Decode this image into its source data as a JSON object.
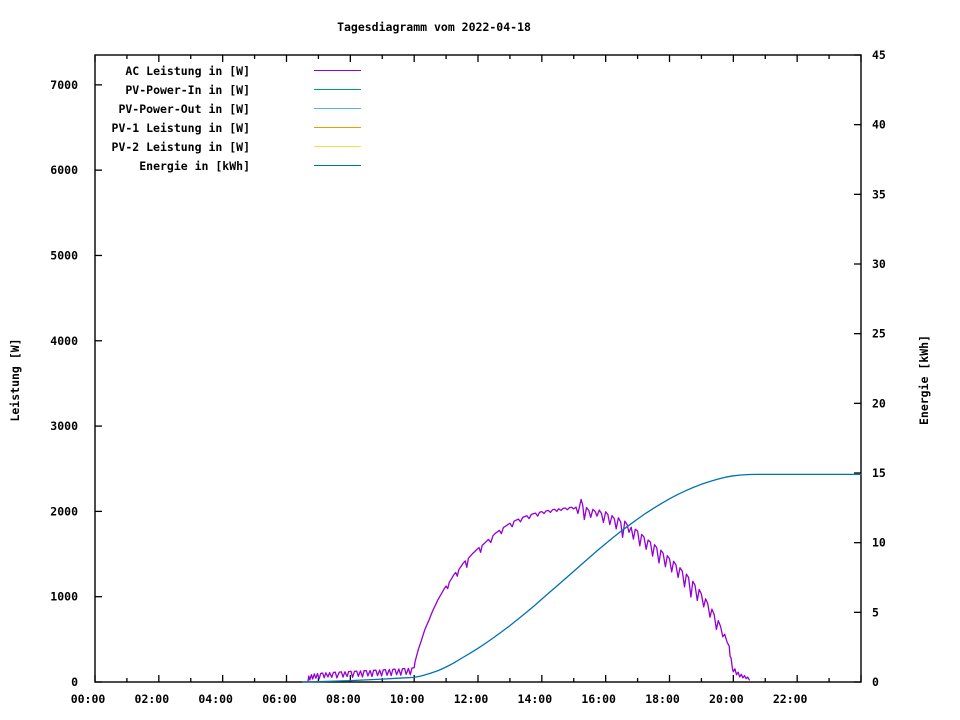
{
  "chart_data": {
    "type": "line",
    "title": "Tagesdiagramm vom 2022-04-18",
    "x_axis": {
      "label": "",
      "unit": "time of day",
      "range_hours": [
        0,
        24
      ],
      "major_tick_hours": [
        0,
        2,
        4,
        6,
        8,
        10,
        12,
        14,
        16,
        18,
        20,
        22,
        24
      ],
      "minor_tick_every_hours": 1,
      "tick_labels": [
        "00:00",
        "02:00",
        "04:00",
        "06:00",
        "08:00",
        "10:00",
        "12:00",
        "14:00",
        "16:00",
        "18:00",
        "20:00",
        "22:00"
      ]
    },
    "y_axis_left": {
      "label": "Leistung [W]",
      "range": [
        0,
        7350
      ],
      "ticks": [
        0,
        1000,
        2000,
        3000,
        4000,
        5000,
        6000,
        7000
      ]
    },
    "y_axis_right": {
      "label": "Energie [kWh]",
      "range": [
        0,
        45
      ],
      "ticks": [
        0,
        5,
        10,
        15,
        20,
        25,
        30,
        35,
        40,
        45
      ]
    },
    "grid": "off",
    "legend_position": "top-left-inside",
    "legend": [
      {
        "label": "AC Leistung in [W]",
        "color": "#9400D3"
      },
      {
        "label": "PV-Power-In in [W]",
        "color": "#009E73"
      },
      {
        "label": "PV-Power-Out in [W]",
        "color": "#56B4E9"
      },
      {
        "label": "PV-1 Leistung in [W]",
        "color": "#E69F00"
      },
      {
        "label": "PV-2 Leistung in [W]",
        "color": "#F0E442"
      },
      {
        "label": "Energie in [kWh]",
        "color": "#0072B2"
      }
    ],
    "series": [
      {
        "name": "AC Leistung in [W]",
        "color": "#9400D3",
        "axis": "left",
        "points": [
          [
            6.67,
            5
          ],
          [
            6.7,
            70
          ],
          [
            6.73,
            25
          ],
          [
            6.78,
            85
          ],
          [
            6.82,
            35
          ],
          [
            6.87,
            95
          ],
          [
            6.92,
            45
          ],
          [
            6.97,
            100
          ],
          [
            7.02,
            35
          ],
          [
            7.07,
            100
          ],
          [
            7.13,
            105
          ],
          [
            7.18,
            50
          ],
          [
            7.23,
            108
          ],
          [
            7.3,
            60
          ],
          [
            7.35,
            110
          ],
          [
            7.42,
            55
          ],
          [
            7.47,
            112
          ],
          [
            7.53,
            115
          ],
          [
            7.58,
            48
          ],
          [
            7.65,
            115
          ],
          [
            7.72,
            118
          ],
          [
            7.77,
            58
          ],
          [
            7.83,
            120
          ],
          [
            7.9,
            65
          ],
          [
            7.95,
            122
          ],
          [
            8.02,
            125
          ],
          [
            8.07,
            55
          ],
          [
            8.13,
            126
          ],
          [
            8.2,
            128
          ],
          [
            8.25,
            68
          ],
          [
            8.32,
            130
          ],
          [
            8.38,
            60
          ],
          [
            8.43,
            132
          ],
          [
            8.5,
            134
          ],
          [
            8.55,
            72
          ],
          [
            8.62,
            135
          ],
          [
            8.68,
            65
          ],
          [
            8.73,
            137
          ],
          [
            8.8,
            138
          ],
          [
            8.85,
            75
          ],
          [
            8.92,
            140
          ],
          [
            8.98,
            70
          ],
          [
            9.03,
            142
          ],
          [
            9.1,
            144
          ],
          [
            9.15,
            80
          ],
          [
            9.22,
            146
          ],
          [
            9.28,
            75
          ],
          [
            9.33,
            148
          ],
          [
            9.4,
            150
          ],
          [
            9.45,
            85
          ],
          [
            9.52,
            152
          ],
          [
            9.58,
            80
          ],
          [
            9.63,
            155
          ],
          [
            9.7,
            158
          ],
          [
            9.75,
            90
          ],
          [
            9.82,
            160
          ],
          [
            9.88,
            85
          ],
          [
            9.93,
            163
          ],
          [
            10.0,
            168
          ],
          [
            10.03,
            240
          ],
          [
            10.08,
            310
          ],
          [
            10.13,
            380
          ],
          [
            10.2,
            460
          ],
          [
            10.27,
            540
          ],
          [
            10.33,
            610
          ],
          [
            10.4,
            670
          ],
          [
            10.47,
            730
          ],
          [
            10.53,
            790
          ],
          [
            10.6,
            850
          ],
          [
            10.67,
            905
          ],
          [
            10.73,
            955
          ],
          [
            10.8,
            1000
          ],
          [
            10.87,
            1045
          ],
          [
            10.93,
            1085
          ],
          [
            11.0,
            1125
          ],
          [
            11.05,
            1095
          ],
          [
            11.1,
            1170
          ],
          [
            11.17,
            1210
          ],
          [
            11.23,
            1250
          ],
          [
            11.3,
            1285
          ],
          [
            11.35,
            1240
          ],
          [
            11.4,
            1320
          ],
          [
            11.47,
            1355
          ],
          [
            11.53,
            1390
          ],
          [
            11.6,
            1420
          ],
          [
            11.65,
            1345
          ],
          [
            11.7,
            1450
          ],
          [
            11.77,
            1480
          ],
          [
            11.83,
            1505
          ],
          [
            11.9,
            1530
          ],
          [
            11.97,
            1555
          ],
          [
            12.03,
            1575
          ],
          [
            12.08,
            1520
          ],
          [
            12.13,
            1600
          ],
          [
            12.2,
            1625
          ],
          [
            12.27,
            1650
          ],
          [
            12.33,
            1672
          ],
          [
            12.4,
            1635
          ],
          [
            12.47,
            1715
          ],
          [
            12.53,
            1738
          ],
          [
            12.6,
            1758
          ],
          [
            12.67,
            1778
          ],
          [
            12.73,
            1740
          ],
          [
            12.8,
            1812
          ],
          [
            12.87,
            1828
          ],
          [
            12.93,
            1845
          ],
          [
            13.0,
            1860
          ],
          [
            13.07,
            1820
          ],
          [
            13.13,
            1885
          ],
          [
            13.2,
            1898
          ],
          [
            13.27,
            1910
          ],
          [
            13.33,
            1878
          ],
          [
            13.4,
            1930
          ],
          [
            13.47,
            1940
          ],
          [
            13.53,
            1950
          ],
          [
            13.6,
            1915
          ],
          [
            13.67,
            1965
          ],
          [
            13.73,
            1972
          ],
          [
            13.8,
            1980
          ],
          [
            13.87,
            1945
          ],
          [
            13.93,
            1990
          ],
          [
            14.0,
            1998
          ],
          [
            14.07,
            1975
          ],
          [
            14.13,
            2005
          ],
          [
            14.2,
            2012
          ],
          [
            14.27,
            1988
          ],
          [
            14.33,
            2018
          ],
          [
            14.4,
            2025
          ],
          [
            14.47,
            2000
          ],
          [
            14.53,
            2030
          ],
          [
            14.6,
            2012
          ],
          [
            14.67,
            2035
          ],
          [
            14.73,
            2040
          ],
          [
            14.8,
            2020
          ],
          [
            14.87,
            2045
          ],
          [
            14.93,
            2048
          ],
          [
            15.0,
            2030
          ],
          [
            15.07,
            2050
          ],
          [
            15.13,
            1975
          ],
          [
            15.18,
            2055
          ],
          [
            15.23,
            2140
          ],
          [
            15.28,
            2075
          ],
          [
            15.33,
            1905
          ],
          [
            15.4,
            2045
          ],
          [
            15.47,
            2010
          ],
          [
            15.53,
            1930
          ],
          [
            15.6,
            2025
          ],
          [
            15.67,
            2000
          ],
          [
            15.73,
            1945
          ],
          [
            15.8,
            2015
          ],
          [
            15.87,
            1975
          ],
          [
            15.93,
            1870
          ],
          [
            16.0,
            1995
          ],
          [
            16.07,
            1960
          ],
          [
            16.13,
            1845
          ],
          [
            16.2,
            1950
          ],
          [
            16.27,
            1915
          ],
          [
            16.33,
            1795
          ],
          [
            16.4,
            1925
          ],
          [
            16.47,
            1875
          ],
          [
            16.53,
            1695
          ],
          [
            16.6,
            1885
          ],
          [
            16.67,
            1845
          ],
          [
            16.73,
            1755
          ],
          [
            16.8,
            1815
          ],
          [
            16.87,
            1675
          ],
          [
            16.93,
            1790
          ],
          [
            17.0,
            1770
          ],
          [
            17.07,
            1595
          ],
          [
            17.13,
            1730
          ],
          [
            17.2,
            1700
          ],
          [
            17.27,
            1555
          ],
          [
            17.33,
            1665
          ],
          [
            17.4,
            1640
          ],
          [
            17.47,
            1475
          ],
          [
            17.53,
            1610
          ],
          [
            17.6,
            1575
          ],
          [
            17.67,
            1395
          ],
          [
            17.73,
            1545
          ],
          [
            17.8,
            1510
          ],
          [
            17.87,
            1350
          ],
          [
            17.93,
            1480
          ],
          [
            18.0,
            1445
          ],
          [
            18.07,
            1290
          ],
          [
            18.13,
            1415
          ],
          [
            18.2,
            1375
          ],
          [
            18.27,
            1225
          ],
          [
            18.33,
            1340
          ],
          [
            18.4,
            1300
          ],
          [
            18.47,
            1115
          ],
          [
            18.53,
            1265
          ],
          [
            18.6,
            1225
          ],
          [
            18.67,
            995
          ],
          [
            18.73,
            1180
          ],
          [
            18.8,
            1135
          ],
          [
            18.87,
            955
          ],
          [
            18.93,
            1085
          ],
          [
            19.0,
            1030
          ],
          [
            19.07,
            880
          ],
          [
            19.13,
            975
          ],
          [
            19.2,
            915
          ],
          [
            19.27,
            760
          ],
          [
            19.33,
            855
          ],
          [
            19.4,
            790
          ],
          [
            19.47,
            615
          ],
          [
            19.53,
            720
          ],
          [
            19.6,
            650
          ],
          [
            19.67,
            530
          ],
          [
            19.73,
            560
          ],
          [
            19.8,
            470
          ],
          [
            19.87,
            420
          ],
          [
            19.9,
            300
          ],
          [
            19.93,
            280
          ],
          [
            19.97,
            160
          ],
          [
            20.0,
            120
          ],
          [
            20.05,
            155
          ],
          [
            20.1,
            85
          ],
          [
            20.15,
            115
          ],
          [
            20.2,
            60
          ],
          [
            20.25,
            90
          ],
          [
            20.3,
            48
          ],
          [
            20.35,
            75
          ],
          [
            20.4,
            40
          ],
          [
            20.45,
            58
          ],
          [
            20.5,
            25
          ]
        ]
      },
      {
        "name": "PV-Power-In in [W]",
        "color": "#009E73",
        "axis": "left",
        "points": []
      },
      {
        "name": "PV-Power-Out in [W]",
        "color": "#56B4E9",
        "axis": "left",
        "points": []
      },
      {
        "name": "PV-1 Leistung in [W]",
        "color": "#E69F00",
        "axis": "left",
        "points": []
      },
      {
        "name": "PV-2 Leistung in [W]",
        "color": "#F0E442",
        "axis": "left",
        "points": []
      },
      {
        "name": "Energie in [kWh]",
        "color": "#0072B2",
        "axis": "right",
        "points": [
          [
            6.5,
            0.0
          ],
          [
            7.0,
            0.02
          ],
          [
            7.5,
            0.06
          ],
          [
            8.0,
            0.1
          ],
          [
            8.5,
            0.15
          ],
          [
            9.0,
            0.21
          ],
          [
            9.5,
            0.27
          ],
          [
            10.0,
            0.33
          ],
          [
            10.25,
            0.45
          ],
          [
            10.5,
            0.62
          ],
          [
            10.75,
            0.82
          ],
          [
            11.0,
            1.08
          ],
          [
            11.25,
            1.38
          ],
          [
            11.5,
            1.72
          ],
          [
            11.75,
            2.06
          ],
          [
            12.0,
            2.42
          ],
          [
            12.25,
            2.8
          ],
          [
            12.5,
            3.2
          ],
          [
            12.75,
            3.62
          ],
          [
            13.0,
            4.05
          ],
          [
            13.25,
            4.5
          ],
          [
            13.5,
            4.97
          ],
          [
            13.75,
            5.45
          ],
          [
            14.0,
            5.95
          ],
          [
            14.25,
            6.45
          ],
          [
            14.5,
            6.95
          ],
          [
            14.75,
            7.45
          ],
          [
            15.0,
            7.95
          ],
          [
            15.25,
            8.45
          ],
          [
            15.5,
            8.95
          ],
          [
            15.75,
            9.45
          ],
          [
            16.0,
            9.93
          ],
          [
            16.25,
            10.4
          ],
          [
            16.5,
            10.85
          ],
          [
            16.75,
            11.28
          ],
          [
            17.0,
            11.7
          ],
          [
            17.25,
            12.1
          ],
          [
            17.5,
            12.47
          ],
          [
            17.75,
            12.82
          ],
          [
            18.0,
            13.15
          ],
          [
            18.25,
            13.45
          ],
          [
            18.5,
            13.72
          ],
          [
            18.75,
            13.97
          ],
          [
            19.0,
            14.19
          ],
          [
            19.25,
            14.38
          ],
          [
            19.5,
            14.55
          ],
          [
            19.75,
            14.7
          ],
          [
            20.0,
            14.8
          ],
          [
            20.25,
            14.86
          ],
          [
            20.5,
            14.89
          ],
          [
            20.75,
            14.9
          ],
          [
            24.0,
            14.9
          ]
        ]
      }
    ],
    "annotations": {
      "final_energy_kwh": 14.9,
      "peak_ac_power_w": 2140
    }
  }
}
